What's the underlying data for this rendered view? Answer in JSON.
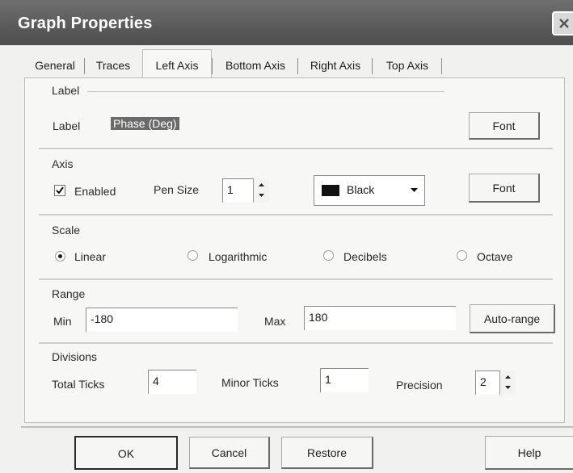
{
  "window": {
    "title": "Graph Properties"
  },
  "tabs": [
    {
      "label": "General"
    },
    {
      "label": "Traces"
    },
    {
      "label": "Left Axis",
      "active": true
    },
    {
      "label": "Bottom Axis"
    },
    {
      "label": "Right Axis"
    },
    {
      "label": "Top Axis"
    }
  ],
  "label_group": {
    "title": "Label",
    "label_text": "Label",
    "value": "Phase (Deg)",
    "font_button": "Font"
  },
  "axis_group": {
    "title": "Axis",
    "enabled_label": "Enabled",
    "enabled_checked": true,
    "pen_size_label": "Pen Size",
    "pen_size_value": "1",
    "color_name": "Black",
    "color_swatch": "#111111",
    "font_button": "Font"
  },
  "scale_group": {
    "title": "Scale",
    "options": [
      {
        "label": "Linear",
        "selected": true
      },
      {
        "label": "Logarithmic",
        "selected": false
      },
      {
        "label": "Decibels",
        "selected": false
      },
      {
        "label": "Octave",
        "selected": false
      }
    ]
  },
  "range_group": {
    "title": "Range",
    "min_label": "Min",
    "min_value": "-180",
    "max_label": "Max",
    "max_value": "180",
    "autorange_button": "Auto-range"
  },
  "divisions_group": {
    "title": "Divisions",
    "total_ticks_label": "Total Ticks",
    "total_ticks_value": "4",
    "minor_ticks_label": "Minor Ticks",
    "minor_ticks_value": "1",
    "precision_label": "Precision",
    "precision_value": "2"
  },
  "footer": {
    "ok": "OK",
    "cancel": "Cancel",
    "restore": "Restore",
    "help": "Help"
  }
}
